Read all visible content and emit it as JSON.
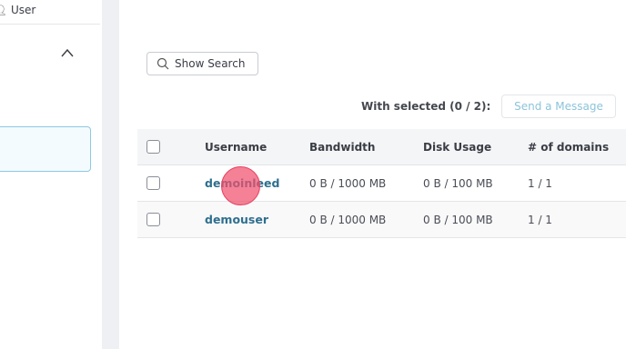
{
  "sidebar": {
    "user_label": "User"
  },
  "toolbar": {
    "show_search_label": "Show Search",
    "with_selected_label": "With selected (0 / 2):",
    "send_message_label": "Send a Message"
  },
  "table": {
    "headers": {
      "username": "Username",
      "bandwidth": "Bandwidth",
      "disk_usage": "Disk Usage",
      "domains": "# of domains"
    },
    "rows": [
      {
        "username": "demoinleed",
        "bandwidth": "0 B / 1000 MB",
        "disk_usage": "0 B / 100 MB",
        "domains": "1 / 1"
      },
      {
        "username": "demouser",
        "bandwidth": "0 B / 1000 MB",
        "disk_usage": "0 B / 100 MB",
        "domains": "1 / 1"
      }
    ]
  },
  "colors": {
    "link": "#2e6f8e",
    "send_message_text": "#8cc4db",
    "selected_border": "#8ec9e0",
    "click_marker": "#e8415f"
  }
}
